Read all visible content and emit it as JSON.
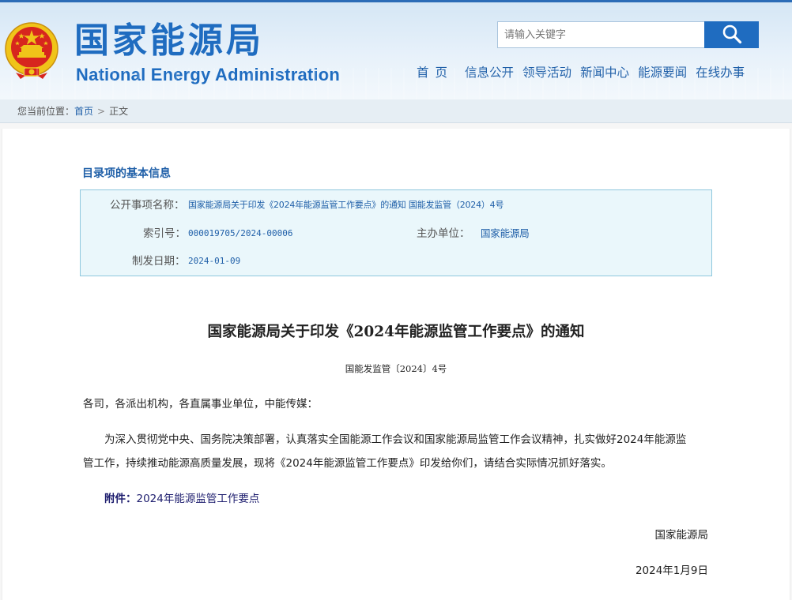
{
  "header": {
    "title_cn": "国家能源局",
    "title_en": "National Energy Administration",
    "emblem_icon": "national-emblem-icon"
  },
  "search": {
    "placeholder": "请输入关键字",
    "icon": "search-icon"
  },
  "nav": [
    {
      "label": "首页"
    },
    {
      "label": "信息公开"
    },
    {
      "label": "领导活动"
    },
    {
      "label": "新闻中心"
    },
    {
      "label": "能源要闻"
    },
    {
      "label": "在线办事"
    }
  ],
  "breadcrumb": {
    "prefix": "您当前位置：",
    "home": "首页",
    "separator": ">",
    "current": "正文"
  },
  "info": {
    "heading": "目录项的基本信息",
    "name_label": "公开事项名称：",
    "name_value": "国家能源局关于印发《2024年能源监管工作要点》的通知 国能发监管（2024）4号",
    "index_label": "索引号：",
    "index_value": "000019705/2024-00006",
    "org_label": "主办单位：",
    "org_value": "国家能源局",
    "date_label": "制发日期：",
    "date_value": "2024-01-09"
  },
  "document": {
    "title": "国家能源局关于印发《2024年能源监管工作要点》的通知",
    "number": "国能发监管〔2024〕4号",
    "salutation": "各司，各派出机构，各直属事业单位，中能传媒：",
    "body_line1": "为深入贯彻党中央、国务院决策部署，认真落实全国能源工作会议和国家能源局监管工作会议精神，扎实做好2024年能源监",
    "body_line2": "管工作，持续推动能源高质量发展，现将《2024年能源监管工作要点》印发给你们，请结合实际情况抓好落实。",
    "attachment_label": "附件：",
    "attachment_link": "2024年能源监管工作要点",
    "signature": "国家能源局",
    "date": "2024年1月9日"
  },
  "colors": {
    "brand_blue": "#1f6cc0",
    "link_blue": "#1f5fa8",
    "info_bg": "#eaf7fb",
    "info_border": "#8ec7de",
    "emblem_red": "#d7261e",
    "emblem_gold": "#f0c419"
  }
}
